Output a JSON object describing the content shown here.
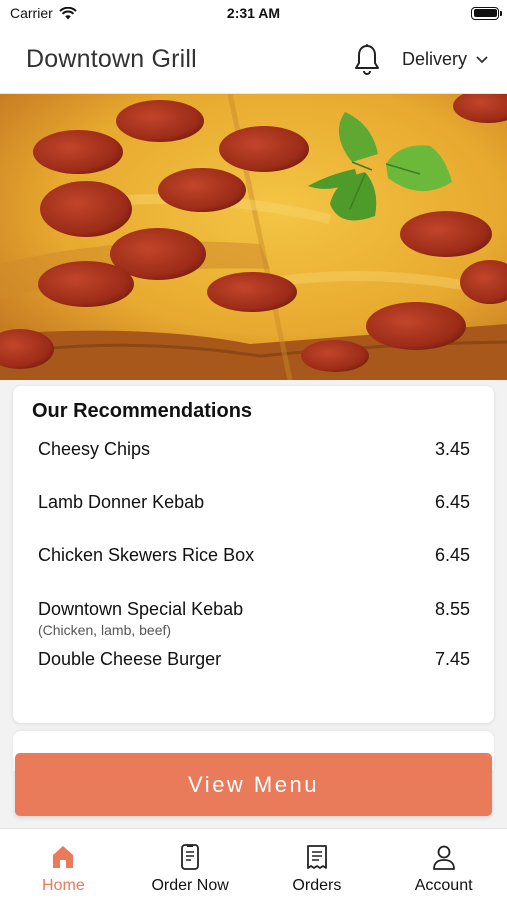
{
  "status_bar": {
    "carrier": "Carrier",
    "time": "2:31 AM"
  },
  "header": {
    "title": "Downtown Grill",
    "delivery_mode": "Delivery"
  },
  "recommendations": {
    "title": "Our Recommendations",
    "items": [
      {
        "name": "Cheesy Chips",
        "price": "3.45",
        "sub": ""
      },
      {
        "name": "Lamb Donner Kebab",
        "price": "6.45",
        "sub": ""
      },
      {
        "name": "Chicken Skewers Rice Box",
        "price": "6.45",
        "sub": ""
      },
      {
        "name": "Downtown Special Kebab",
        "price": "8.55",
        "sub": "(Chicken, lamb, beef)"
      },
      {
        "name": "Double Cheese Burger",
        "price": "7.45",
        "sub": ""
      }
    ]
  },
  "view_menu_label": "View Menu",
  "tabs": [
    {
      "label": "Home",
      "icon": "home-icon",
      "active": true
    },
    {
      "label": "Order Now",
      "icon": "order-phone-icon",
      "active": false
    },
    {
      "label": "Orders",
      "icon": "receipt-icon",
      "active": false
    },
    {
      "label": "Account",
      "icon": "account-icon",
      "active": false
    }
  ],
  "colors": {
    "accent": "#e97a5a"
  }
}
